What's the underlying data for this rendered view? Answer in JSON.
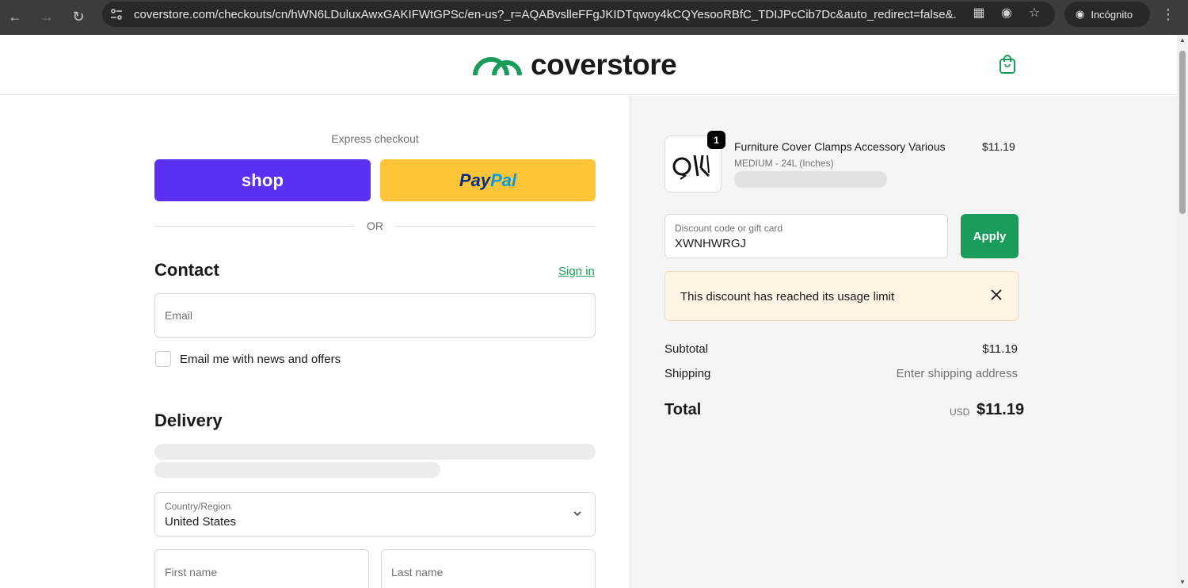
{
  "browser": {
    "url": "coverstore.com/checkouts/cn/hWN6LDuluxAwxGAKIFWtGPSc/en-us?_r=AQABvslleFFgJKIDTqwoy4kCQYesooRBfC_TDIJPcCib7Dc&auto_redirect=false&...",
    "profile_label": "Incógnito"
  },
  "header": {
    "logo_text": "coverstore",
    "brand_color": "#1a9d5c"
  },
  "express": {
    "label": "Express checkout",
    "shop_label": "shop",
    "paypal_label_1": "Pay",
    "paypal_label_2": "Pal",
    "or_label": "OR"
  },
  "contact": {
    "title": "Contact",
    "signin_label": "Sign in",
    "email_placeholder": "Email",
    "newsletter_label": "Email me with news and offers",
    "newsletter_checked": false
  },
  "delivery": {
    "title": "Delivery",
    "country_label": "Country/Region",
    "country_value": "United States",
    "first_name_placeholder": "First name",
    "last_name_placeholder": "Last name"
  },
  "summary": {
    "product": {
      "name": "Furniture Cover Clamps Accessory Various",
      "variant": "MEDIUM - 24L (Inches)",
      "price": "$11.19",
      "quantity": "1"
    },
    "discount": {
      "label": "Discount code or gift card",
      "value": "XWNHWRGJ",
      "apply_label": "Apply",
      "error_message": "This discount has reached its usage limit"
    },
    "subtotal_label": "Subtotal",
    "subtotal_value": "$11.19",
    "shipping_label": "Shipping",
    "shipping_value": "Enter shipping address",
    "total_label": "Total",
    "total_currency": "USD",
    "total_value": "$11.19"
  }
}
